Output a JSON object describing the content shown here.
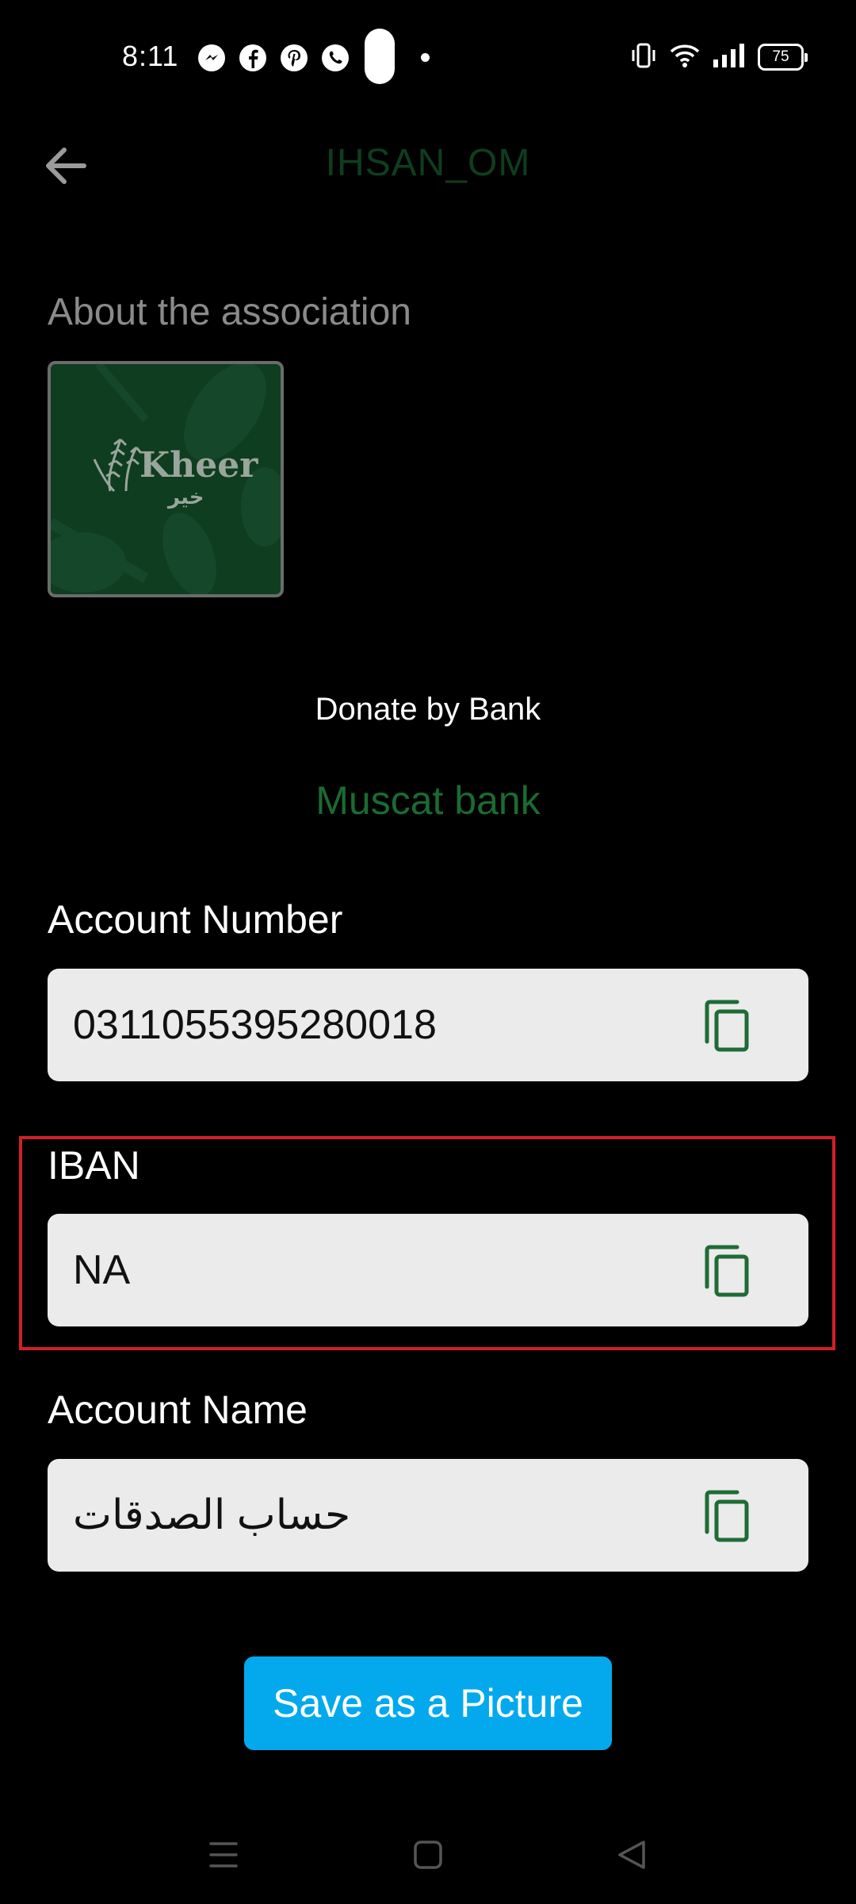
{
  "status_bar": {
    "time": "8:11",
    "battery": "75",
    "app_icons": [
      "messenger-icon",
      "facebook-icon",
      "pinterest-icon",
      "whatsapp-icon"
    ],
    "right_icons": [
      "vibrate-icon",
      "wifi-icon",
      "signal-icon",
      "battery-icon"
    ]
  },
  "header": {
    "title": "IHSAN_OM",
    "back_icon": "arrow-left-icon"
  },
  "about": {
    "title": "About the association",
    "logo_text": "Kheer",
    "logo_arabic": "خير"
  },
  "donation": {
    "label": "Donate by Bank",
    "bank_name": "Muscat bank"
  },
  "fields": {
    "account_number": {
      "label": "Account Number",
      "value": "0311055395280018"
    },
    "iban": {
      "label": "IBAN",
      "value": "NA"
    },
    "account_name": {
      "label": "Account Name",
      "value": "حساب الصدقات"
    }
  },
  "actions": {
    "save_label": "Save as a Picture"
  },
  "nav": [
    "menu-icon",
    "home-icon",
    "back-icon"
  ],
  "colors": {
    "background": "#000000",
    "title_green": "#0f3d1f",
    "bank_green": "#1a6b32",
    "copy_icon_green": "#1f6b36",
    "field_background": "#ebebeb",
    "button_blue": "#03a9ec",
    "highlight_red": "#d0202a"
  }
}
